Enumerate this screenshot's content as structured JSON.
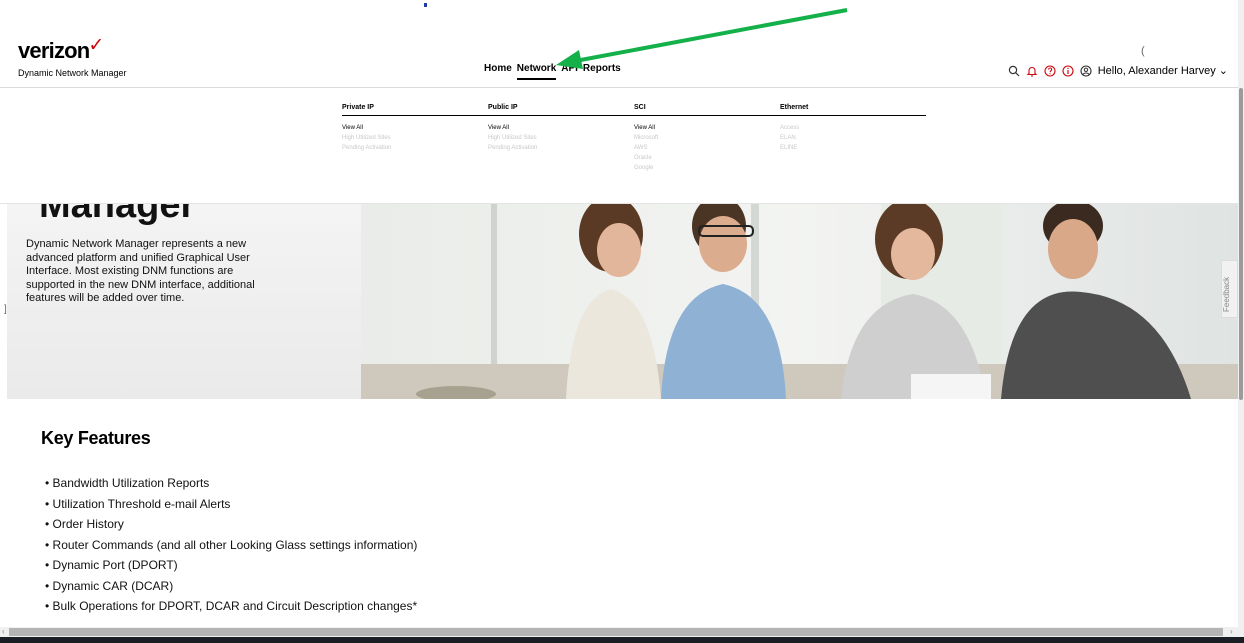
{
  "header": {
    "brand": "verizon",
    "brand_check": "✓",
    "product": "Dynamic Network Manager",
    "nav": [
      {
        "label": "Home"
      },
      {
        "label": "Network"
      },
      {
        "label": "API"
      },
      {
        "label": "Reports"
      }
    ],
    "greeting": "Hello, Alexander Harvey",
    "chevron": "⌄"
  },
  "icons": {
    "search": "search-icon",
    "bell": "bell-icon",
    "help": "help-icon",
    "info": "info-icon",
    "user": "user-icon"
  },
  "colors": {
    "accent": "#cd040b",
    "annotation_arrow": "#14b04a"
  },
  "network_menu": {
    "columns": [
      {
        "heading": "Private IP",
        "links": [
          "View All",
          "High Utilized Sites",
          "Pending Activation"
        ]
      },
      {
        "heading": "Public IP",
        "links": [
          "View All",
          "High Utilized Sites",
          "Pending Activation"
        ]
      },
      {
        "heading": "SCI",
        "links": [
          "View All",
          "Microsoft",
          "AWS",
          "Oracle",
          "Google"
        ]
      },
      {
        "heading": "Ethernet",
        "links": [
          "Access",
          "ELAN",
          "ELINE"
        ]
      }
    ]
  },
  "hero": {
    "title": "Manager",
    "description": "Dynamic Network Manager represents a new advanced platform and unified Graphical User Interface. Most existing DNM functions are supported in the new DNM interface, additional features will be added over time.",
    "feedback": "Feedback"
  },
  "key_features": {
    "title": "Key Features",
    "items": [
      "Bandwidth Utilization Reports",
      "Utilization Threshold e-mail Alerts",
      "Order History",
      "Router Commands (and all other Looking Glass settings information)",
      "Dynamic Port (DPORT)",
      "Dynamic CAR (DCAR)",
      "Bulk Operations for DPORT, DCAR and Circuit Description changes*"
    ]
  }
}
